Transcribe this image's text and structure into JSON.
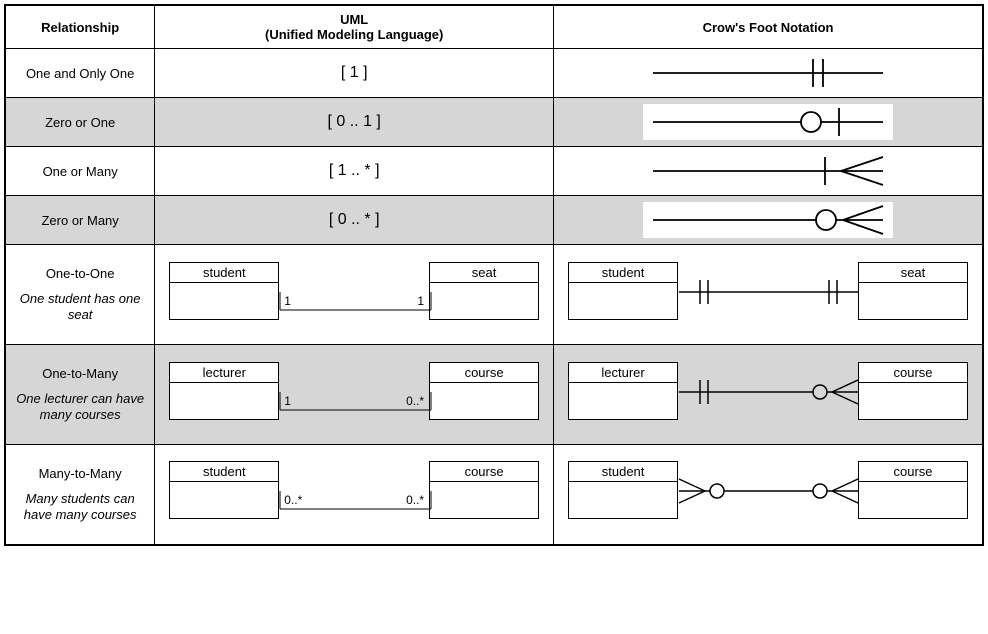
{
  "headers": {
    "relationship": "Relationship",
    "uml_line1": "UML",
    "uml_line2": "(Unified Modeling Language)",
    "crowfoot": "Crow's Foot Notation"
  },
  "rows": [
    {
      "name": "One and Only One",
      "uml": "[ 1 ]",
      "cf_type": "one-one",
      "shade": false
    },
    {
      "name": "Zero or One",
      "uml": "[ 0 .. 1 ]",
      "cf_type": "zero-one",
      "shade": true
    },
    {
      "name": "One or Many",
      "uml": "[ 1 .. * ]",
      "cf_type": "one-many",
      "shade": false
    },
    {
      "name": "Zero or Many",
      "uml": "[ 0 .. * ]",
      "cf_type": "zero-many",
      "shade": true
    }
  ],
  "examples": [
    {
      "name": "One-to-One",
      "desc": "One student has one seat",
      "left": "student",
      "right": "seat",
      "uml_left_card": "1",
      "uml_right_card": "1",
      "cf_left": "one-one",
      "cf_right": "one-one",
      "shade": false
    },
    {
      "name": "One-to-Many",
      "desc": "One lecturer can have many courses",
      "left": "lecturer",
      "right": "course",
      "uml_left_card": "1",
      "uml_right_card": "0..*",
      "cf_left": "one-one",
      "cf_right": "zero-many",
      "shade": true
    },
    {
      "name": "Many-to-Many",
      "desc": "Many students can have many courses",
      "left": "student",
      "right": "course",
      "uml_left_card": "0..*",
      "uml_right_card": "0..*",
      "cf_left": "zero-many-rev",
      "cf_right": "zero-many",
      "shade": false
    }
  ]
}
